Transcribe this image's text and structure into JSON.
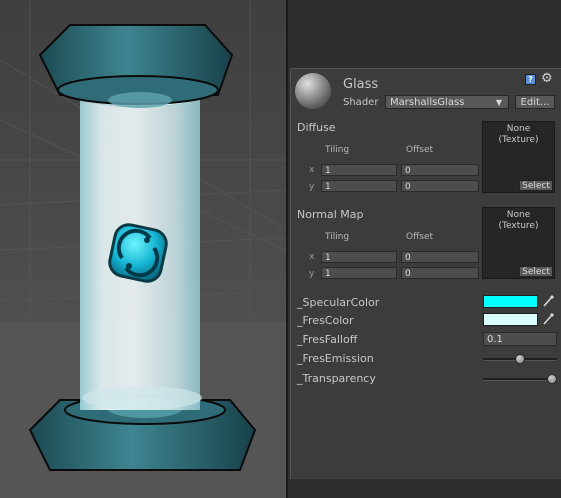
{
  "material": {
    "name": "Glass",
    "shader_label": "Shader",
    "shader_value": "MarshallsGlass",
    "edit_label": "Edit..."
  },
  "diffuse": {
    "title": "Diffuse",
    "tiling_label": "Tiling",
    "offset_label": "Offset",
    "x_label": "x",
    "y_label": "y",
    "tiling_x": "1",
    "tiling_y": "1",
    "offset_x": "0",
    "offset_y": "0",
    "texture_line1": "None",
    "texture_line2": "(Texture)",
    "select_label": "Select"
  },
  "normal_map": {
    "title": "Normal Map",
    "tiling_label": "Tiling",
    "offset_label": "Offset",
    "x_label": "x",
    "y_label": "y",
    "tiling_x": "1",
    "tiling_y": "1",
    "offset_x": "0",
    "offset_y": "0",
    "texture_line1": "None",
    "texture_line2": "(Texture)",
    "select_label": "Select"
  },
  "properties": {
    "specular_label": "_SpecularColor",
    "specular_color": "#00ffff",
    "fres_color_label": "_FresColor",
    "fres_color": "#d9ffff",
    "fres_falloff_label": "_FresFalloff",
    "fres_falloff_value": "0.1",
    "fres_emission_label": "_FresEmission",
    "fres_emission_level": 0.5,
    "transparency_label": "_Transparency",
    "transparency_level": 1.0
  },
  "icons": {
    "help": "help-book-icon",
    "settings": "gear-icon",
    "picker": "eyedropper-icon"
  }
}
